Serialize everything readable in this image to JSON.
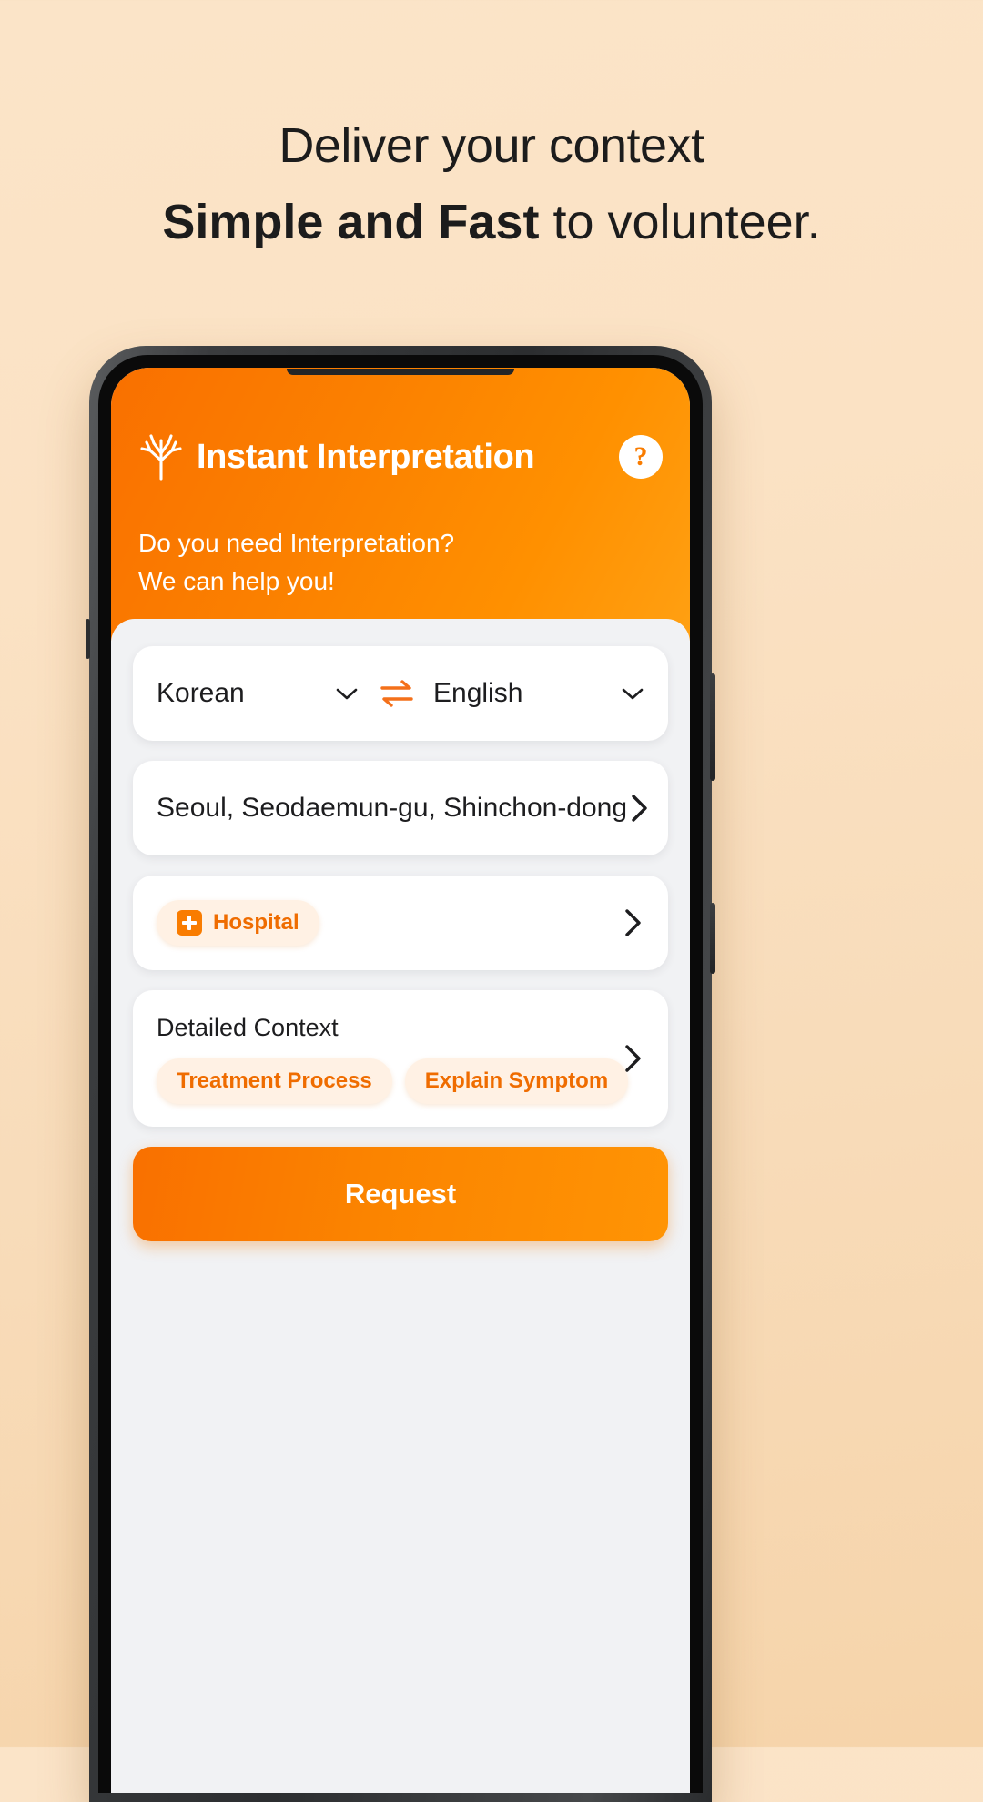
{
  "promo": {
    "line1": "Deliver your context",
    "line2_bold": "Simple and Fast",
    "line2_rest": " to volunteer."
  },
  "app": {
    "header": {
      "logo_icon": "tree-icon",
      "title": "Instant Interpretation",
      "help_icon": "question-mark-icon",
      "help_label": "?"
    },
    "subtitle": {
      "line1": "Do you need Interpretation?",
      "line2": "We can help you!"
    },
    "language_card": {
      "source": "Korean",
      "target": "English",
      "swap_icon": "swap-horizontal-icon",
      "source_chevron": "chevron-down-icon",
      "target_chevron": "chevron-down-icon"
    },
    "location_card": {
      "address": "Seoul, Seodaemun-gu, Shinchon-dong",
      "arrow_icon": "chevron-right-icon"
    },
    "category_card": {
      "chip_label": "Hospital",
      "chip_icon": "medical-cross-icon",
      "arrow_icon": "chevron-right-icon"
    },
    "context_card": {
      "title": "Detailed Context",
      "chips": [
        "Treatment Process",
        "Explain Symptom"
      ],
      "arrow_icon": "chevron-right-icon"
    },
    "request_button": {
      "label": "Request"
    }
  },
  "colors": {
    "background_top": "#fbe4c8",
    "background_bottom": "#f6d4aa",
    "brand_orange": "#f97c00",
    "accent_orange": "#ef6c00",
    "chip_bg": "#fff1e4",
    "sheet_bg": "#f1f2f4",
    "text_dark": "#1d1d1f"
  }
}
